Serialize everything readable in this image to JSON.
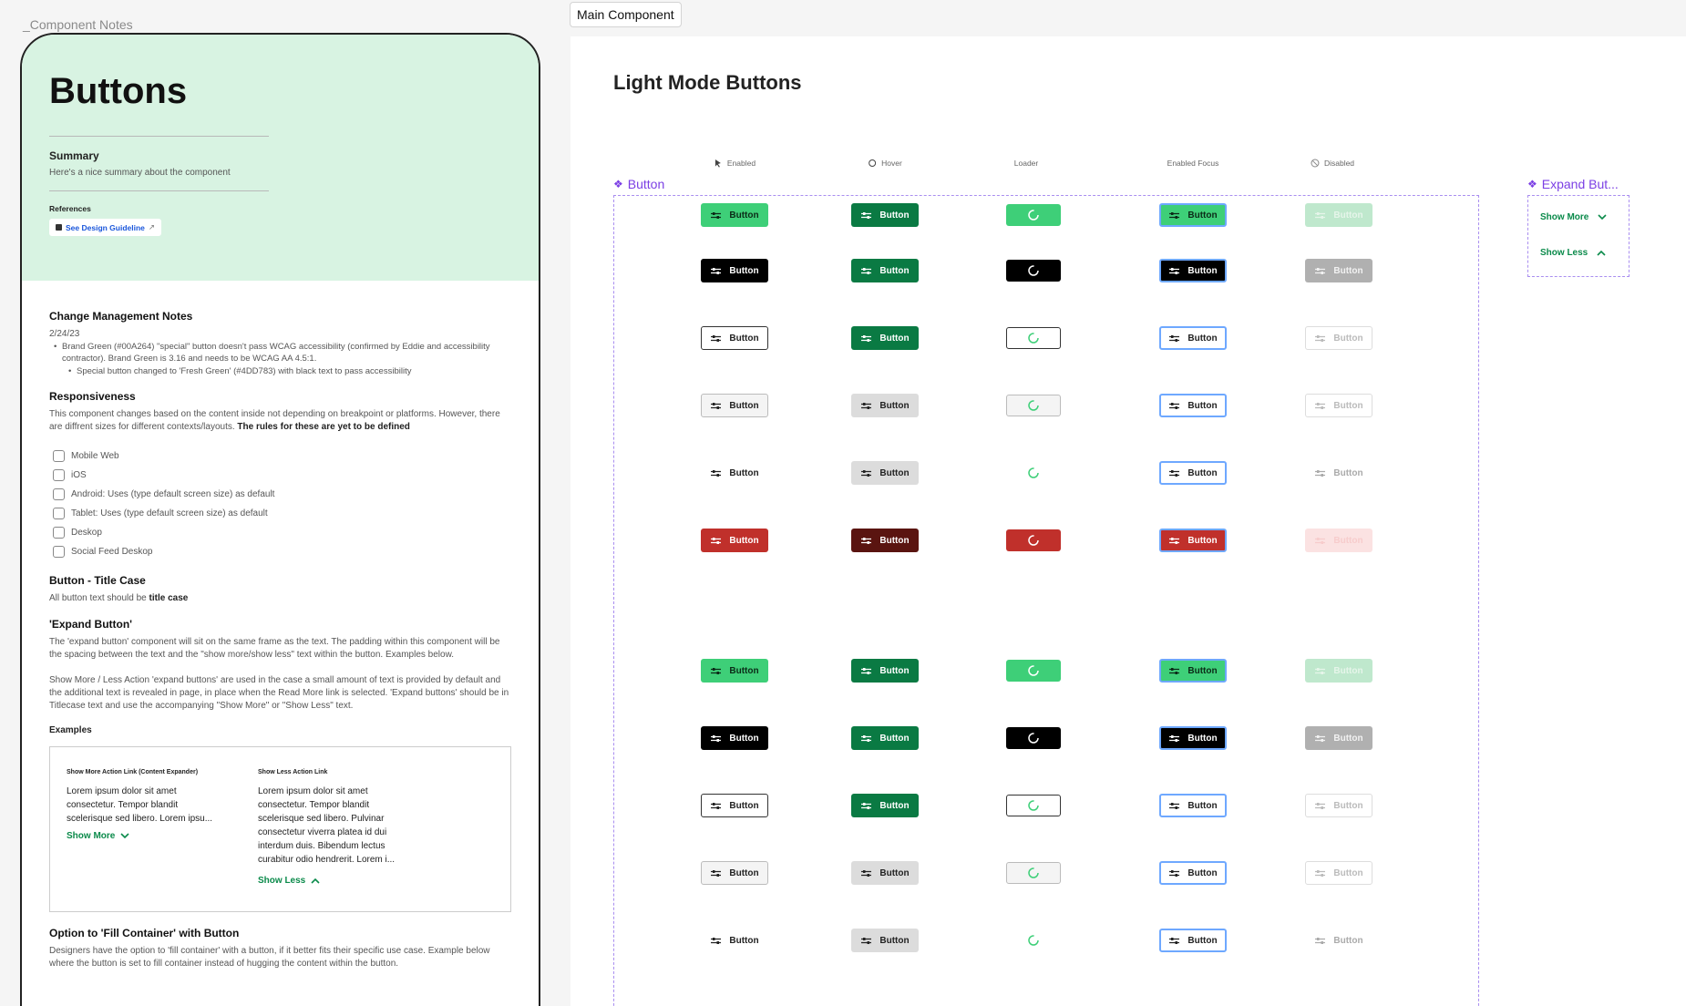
{
  "left_frame_label": "_Component Notes",
  "notes": {
    "title": "Buttons",
    "summary_heading": "Summary",
    "summary_text": "Here's a nice summary about the component",
    "references_heading": "References",
    "reference_link": "See Design Guideline",
    "change_heading": "Change Management Notes",
    "change_date": "2/24/23",
    "change_items": [
      "Brand Green (#00A264) \"special\" button doesn't pass WCAG accessibility (confirmed by Eddie and accessibility contractor). Brand Green is 3.16 and needs to be WCAG AA 4.5:1.",
      "Special button changed to 'Fresh Green' (#4DD783) with black text to pass accessibility"
    ],
    "responsiveness_heading": "Responsiveness",
    "responsiveness_text": "This component changes based on the content inside not depending on breakpoint or platforms. However, there are diffrent sizes for different contexts/layouts.",
    "responsiveness_bold": "The rules for these are yet to be defined",
    "checklist": [
      "Mobile Web",
      "iOS",
      "Android: Uses (type default screen size) as default",
      "Tablet: Uses (type default screen size) as default",
      "Deskop",
      "Social Feed Deskop"
    ],
    "titlecase_heading": "Button - Title Case",
    "titlecase_text": "All button text should be",
    "titlecase_bold": "title case",
    "expand_heading": "'Expand Button'",
    "expand_text_1": "The 'expand button' component will sit on the same frame as the text. The padding within this component will be the spacing between the text and the \"show more/show less\" text within the button. Examples below.",
    "expand_text_2": "Show More / Less Action 'expand buttons' are used in the case a small amount of text is provided by default and the additional text is revealed in page, in place when the Read More link is selected. 'Expand buttons' should be in Titlecase text and use the accompanying \"Show More\" or \"Show Less\" text.",
    "examples_heading": "Examples",
    "example_more_title": "Show More Action Link (Content Expander)",
    "example_more_text": "Lorem ipsum dolor sit amet consectetur. Tempor blandit scelerisque sed libero. Lorem ipsu...",
    "example_more_link": "Show More",
    "example_less_title": "Show Less Action Link",
    "example_less_text": "Lorem ipsum dolor sit amet consectetur. Tempor blandit scelerisque sed libero. Pulvinar consectetur viverra platea id dui interdum duis. Bibendum lectus curabitur odio hendrerit. Lorem i...",
    "example_less_link": "Show Less",
    "fill_heading": "Option to 'Fill Container' with Button",
    "fill_text": "Designers have the option to 'fill container' with a button, if it better fits their specific use case. Example below where the button is set to fill container instead of hugging the content within the button."
  },
  "main_label": "Main Component",
  "main_title": "Light Mode Buttons",
  "column_headers": [
    "Enabled",
    "Hover",
    "Loader",
    "Enabled Focus",
    "Disabled"
  ],
  "component_label": "Button",
  "expand_component_label": "Expand But...",
  "expand_items": [
    "Show More",
    "Show Less"
  ],
  "button_label": "Button",
  "colors": {
    "fresh_green": "#4DD783",
    "brand_green": "#00A264",
    "dark_green": "#0a7a43",
    "red": "#c0302b",
    "accent_purple": "#7b3fe4"
  }
}
